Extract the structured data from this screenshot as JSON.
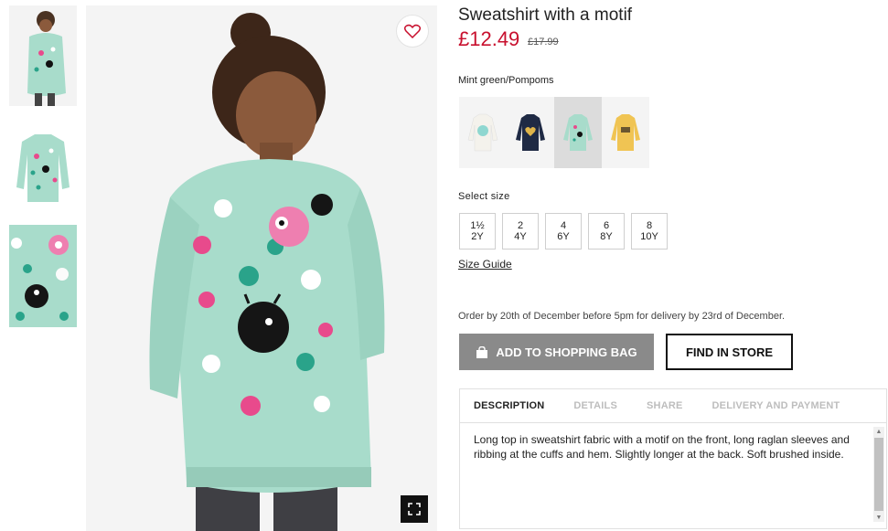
{
  "product": {
    "title": "Sweatshirt with a motif",
    "price": "£12.49",
    "old_price": "£17.99",
    "color_name": "Mint green/Pompoms",
    "favorite_icon": "heart-icon",
    "zoom_icon": "expand-icon"
  },
  "thumbnails": [
    "model-front",
    "garment-flat",
    "motif-closeup"
  ],
  "swatches": [
    {
      "name": "white-monster",
      "color": "#f4f2ec",
      "selected": false
    },
    {
      "name": "navy-heart",
      "color": "#1f2a44",
      "selected": false
    },
    {
      "name": "mint-pompoms",
      "color": "#a8dccb",
      "selected": true
    },
    {
      "name": "yellow-3d",
      "color": "#f0c453",
      "selected": false
    }
  ],
  "sizes": {
    "label": "Select size",
    "options": [
      {
        "top": "1½",
        "bottom": "2Y"
      },
      {
        "top": "2",
        "bottom": "4Y"
      },
      {
        "top": "4",
        "bottom": "6Y"
      },
      {
        "top": "6",
        "bottom": "8Y"
      },
      {
        "top": "8",
        "bottom": "10Y"
      }
    ],
    "guide_label": "Size Guide"
  },
  "delivery_note": "Order by 20th of December before 5pm for delivery by 23rd of December.",
  "actions": {
    "add_to_bag": "ADD TO SHOPPING BAG",
    "bag_icon": "shopping-bag-icon",
    "find_in_store": "FIND IN STORE"
  },
  "tabs": [
    "DESCRIPTION",
    "DETAILS",
    "SHARE",
    "DELIVERY AND PAYMENT"
  ],
  "active_tab": "DESCRIPTION",
  "description": "Long top in sweatshirt fabric with a motif on the front, long raglan sleeves and ribbing at the cuffs and hem. Slightly longer at the back. Soft brushed inside.",
  "colors": {
    "price_red": "#c8102e",
    "button_grey": "#8a8a8a",
    "mint": "#a8dccb"
  }
}
